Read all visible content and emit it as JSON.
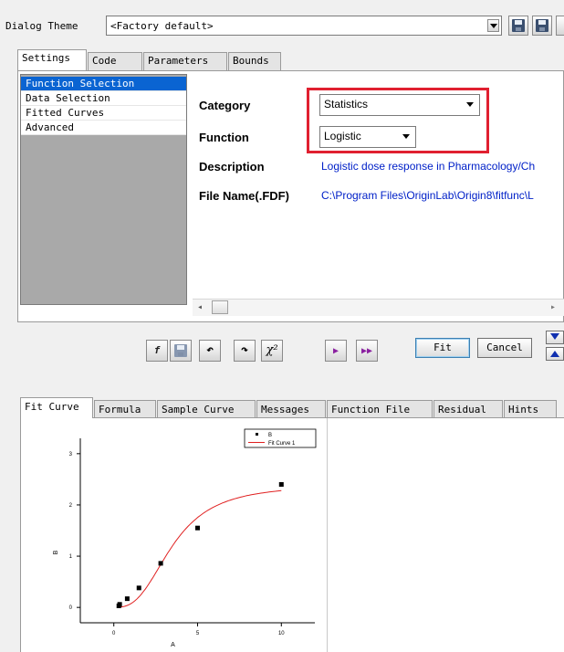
{
  "theme": {
    "label": "Dialog Theme",
    "value": "<Factory default>"
  },
  "top_tabs": [
    "Settings",
    "Code",
    "Parameters",
    "Bounds"
  ],
  "nav_items": [
    "Function Selection",
    "Data Selection",
    "Fitted Curves",
    "Advanced"
  ],
  "fields": {
    "category_label": "Category",
    "category_value": "Statistics",
    "function_label": "Function",
    "function_value": "Logistic",
    "description_label": "Description",
    "description_value": "Logistic dose response in Pharmacology/Ch",
    "filename_label": "File Name(.FDF)",
    "filename_value": "C:\\Program Files\\OriginLab\\Origin8\\fitfunc\\L"
  },
  "toolbar": {
    "chi2_label": "χ²",
    "fit_label": "Fit",
    "cancel_label": "Cancel"
  },
  "bottom_tabs": [
    "Fit Curve",
    "Formula",
    "Sample Curve",
    "Messages",
    "Function File",
    "Residual",
    "Hints"
  ],
  "colors": {
    "highlight": "#e02030",
    "selection": "#0a64d2",
    "link": "#0020c8",
    "curve": "#e02020"
  },
  "chart_data": {
    "type": "scatter",
    "xlabel": "A",
    "ylabel": "B",
    "xlim": [
      -2,
      12
    ],
    "ylim": [
      -0.3,
      3.3
    ],
    "x_ticks": [
      "0",
      "5",
      "10"
    ],
    "y_ticks": [
      "0",
      "1",
      "2",
      "3"
    ],
    "legend": [
      "B",
      "Fit Curve 1"
    ],
    "legend_position": "top-right",
    "series": [
      {
        "name": "B",
        "kind": "points",
        "x": [
          0.3,
          0.35,
          0.8,
          1.5,
          2.8,
          5.0,
          10.0
        ],
        "y": [
          0.03,
          0.06,
          0.17,
          0.38,
          0.86,
          1.55,
          2.4
        ]
      },
      {
        "name": "Fit Curve 1",
        "kind": "line",
        "model": {
          "A1": 0.0,
          "A2": 2.4,
          "x0": 3.5,
          "p": 2.8
        },
        "x_range": [
          0.3,
          10
        ]
      }
    ]
  }
}
